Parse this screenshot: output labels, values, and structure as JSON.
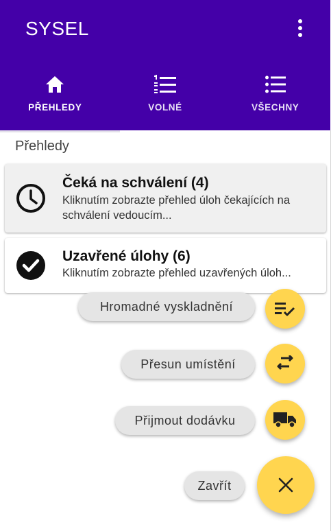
{
  "app": {
    "title": "SYSEL"
  },
  "tabs": [
    {
      "label": "PŘEHLEDY",
      "icon": "home-icon",
      "active": true
    },
    {
      "label": "VOLNÉ",
      "icon": "numbered-list-icon",
      "active": false
    },
    {
      "label": "VŠECHNY",
      "icon": "list-icon",
      "active": false
    }
  ],
  "section": {
    "title": "Přehledy"
  },
  "cards": [
    {
      "title": "Čeká na schválení (4)",
      "description": "Kliknutím zobrazte přehled úloh čekajících na schválení vedoucím...",
      "icon": "clock-icon"
    },
    {
      "title": "Uzavřené úlohy (6)",
      "description": "Kliknutím zobrazte přehled uzavřených úloh...",
      "icon": "check-circle-icon"
    }
  ],
  "speed_dial": {
    "actions": [
      {
        "label": "Hromadné vyskladnění",
        "icon": "playlist-check-icon"
      },
      {
        "label": "Přesun umístění",
        "icon": "swap-arrows-icon"
      },
      {
        "label": "Přijmout dodávku",
        "icon": "truck-icon"
      }
    ],
    "close_label": "Zavřít",
    "close_icon": "close-icon"
  },
  "colors": {
    "primary": "#4400a8",
    "accent": "#ffd54f",
    "card_highlight": "#f0f0f0"
  }
}
